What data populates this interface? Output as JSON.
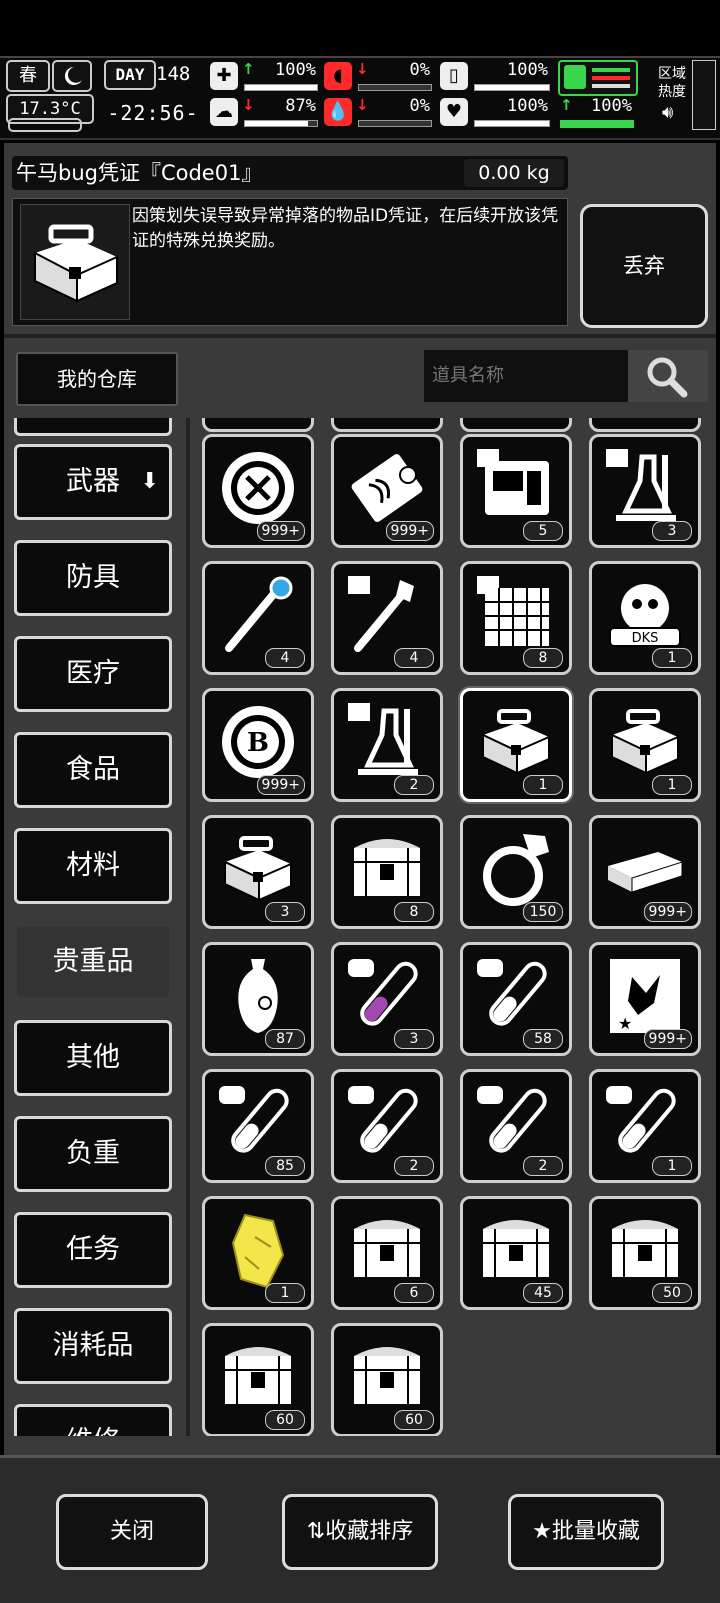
{
  "status": {
    "season": "春",
    "temperature": "17.3°C",
    "day_label": "DAY",
    "day_value": "148",
    "time": "-22:56-",
    "stats": [
      {
        "name": "health",
        "value": "100%",
        "trend": "up",
        "fill": 1.0
      },
      {
        "name": "stomach",
        "value": "0%",
        "trend": "down",
        "fill": 0.0
      },
      {
        "name": "water",
        "value": "100%",
        "trend": "",
        "fill": 1.0
      },
      {
        "name": "stamina",
        "value": "100%",
        "trend": "",
        "fill": 1.0
      },
      {
        "name": "mental",
        "value": "87%",
        "trend": "down",
        "fill": 0.87
      },
      {
        "name": "blood",
        "value": "0%",
        "trend": "down",
        "fill": 0.0
      },
      {
        "name": "heart",
        "value": "100%",
        "trend": "",
        "fill": 1.0
      },
      {
        "name": "energy",
        "value": "100%",
        "trend": "up",
        "fill": 1.0
      }
    ],
    "region_label_1": "区域",
    "region_label_2": "热度",
    "accent_green": "#38d64a",
    "accent_red": "#ff2b2b"
  },
  "item": {
    "name": "午马bug凭证『Code01』",
    "weight": "0.00 kg",
    "description": "因策划失误导致异常掉落的物品ID凭证，在后续开放该凭证的特殊兑换奖励。",
    "discard_label": "丢弃"
  },
  "toolbar": {
    "warehouse_label": "我的仓库",
    "search_placeholder": "道具名称"
  },
  "categories": [
    {
      "label": "武器",
      "has_arrow": true
    },
    {
      "label": "防具"
    },
    {
      "label": "医疗"
    },
    {
      "label": "食品"
    },
    {
      "label": "材料"
    },
    {
      "label": "贵重品",
      "selected": true
    },
    {
      "label": "其他"
    },
    {
      "label": "负重"
    },
    {
      "label": "任务"
    },
    {
      "label": "消耗品"
    },
    {
      "label": "维修"
    }
  ],
  "grid_items": [
    {
      "icon": "coin-tools-icon",
      "count": "999+"
    },
    {
      "icon": "certificate-ticket-icon",
      "count": "999+"
    },
    {
      "icon": "equipment-console-iv-icon",
      "count": "5"
    },
    {
      "icon": "lab-flask-iv-icon",
      "count": "3"
    },
    {
      "icon": "magic-staff-icon",
      "count": "4"
    },
    {
      "icon": "crystal-wand-iv-icon",
      "count": "4"
    },
    {
      "icon": "grid-blueprint-iv-icon",
      "count": "8"
    },
    {
      "icon": "dks-badge-icon",
      "count": "1"
    },
    {
      "icon": "b-coin-icon",
      "count": "999+"
    },
    {
      "icon": "lab-flask-i-icon",
      "count": "2"
    },
    {
      "icon": "toolbox-icon",
      "count": "1",
      "selected": true
    },
    {
      "icon": "toolbox-icon",
      "count": "1"
    },
    {
      "icon": "toolbox-icon",
      "count": "3"
    },
    {
      "icon": "treasure-chest-v-icon",
      "count": "8"
    },
    {
      "icon": "diamond-ring-icon",
      "count": "150"
    },
    {
      "icon": "cash-stack-icon",
      "count": "999+"
    },
    {
      "icon": "porcelain-vase-icon",
      "count": "87"
    },
    {
      "icon": "test-tube-alpha-icon",
      "count": "3"
    },
    {
      "icon": "test-tube-vii-icon",
      "count": "58"
    },
    {
      "icon": "claw-poster-icon",
      "count": "999+"
    },
    {
      "icon": "test-tube-vi-icon",
      "count": "85"
    },
    {
      "icon": "test-tube-iii-icon",
      "count": "2"
    },
    {
      "icon": "test-tube-ii-icon",
      "count": "2"
    },
    {
      "icon": "test-tube-i-icon",
      "count": "1"
    },
    {
      "icon": "gold-ore-icon",
      "count": "1"
    },
    {
      "icon": "treasure-chest-s-icon",
      "count": "6"
    },
    {
      "icon": "treasure-chest-iv-icon",
      "count": "45"
    },
    {
      "icon": "treasure-chest-iii-icon",
      "count": "50"
    },
    {
      "icon": "treasure-chest-ii-icon",
      "count": "60"
    },
    {
      "icon": "treasure-chest-i-icon",
      "count": "60"
    }
  ],
  "bottom": {
    "close_label": "关闭",
    "sort_label": "收藏排序",
    "batch_label": "批量收藏"
  }
}
